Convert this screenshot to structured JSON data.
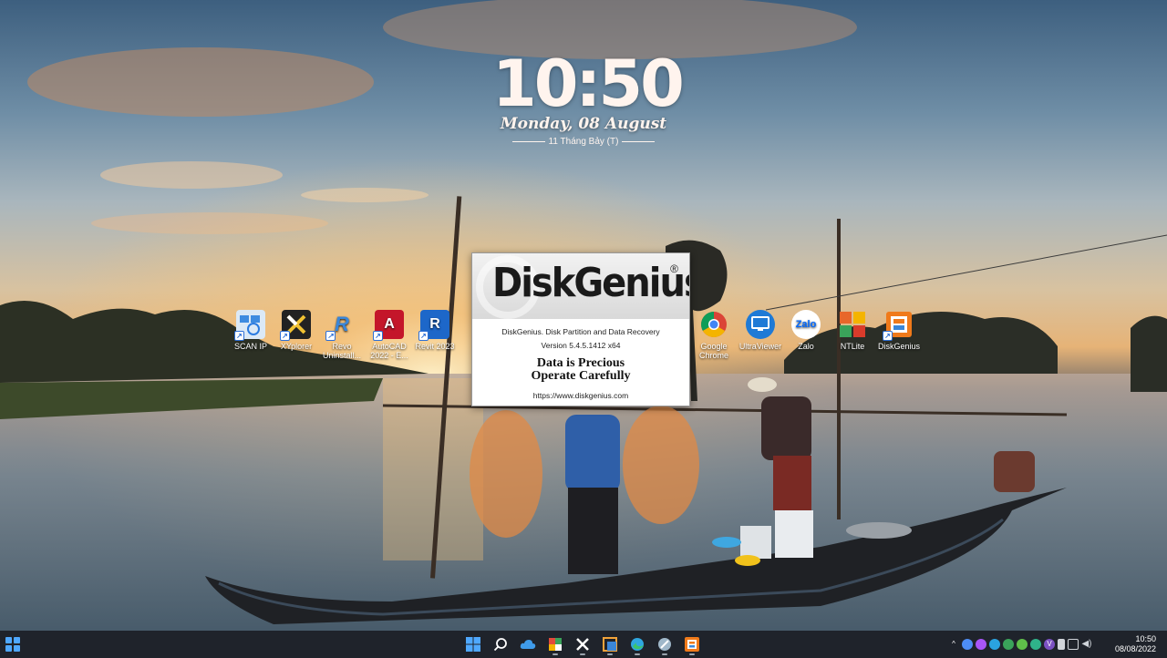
{
  "clock": {
    "time": "10:50",
    "date": "Monday, 08 August",
    "lunar": "11 Tháng Bảy (T)"
  },
  "desktop_icons": [
    {
      "label": "SCAN IP",
      "icon": "scan-ip-icon",
      "color": "#5aa0e0"
    },
    {
      "label": "XYplorer",
      "icon": "xyplorer-icon",
      "color": "#222222"
    },
    {
      "label": "Revo Uninstall...",
      "icon": "revo-uninstaller-icon",
      "color": "#3a86d8"
    },
    {
      "label": "AutoCAD 2022 - E...",
      "icon": "autocad-icon",
      "color": "#c4162a"
    },
    {
      "label": "Revit 2023",
      "icon": "revit-icon",
      "color": "#1d67c9"
    },
    {
      "label": "Google Chrome",
      "icon": "chrome-icon",
      "color": "#4285f4"
    },
    {
      "label": "UltraViewer",
      "icon": "ultraviewer-icon",
      "color": "#1f7ad6"
    },
    {
      "label": "Zalo",
      "icon": "zalo-icon",
      "color": "#0068ff"
    },
    {
      "label": "NTLite",
      "icon": "ntlite-icon",
      "color": "#e8672a"
    },
    {
      "label": "DiskGenius",
      "icon": "diskgenius-icon",
      "color": "#f07a1a"
    }
  ],
  "splash": {
    "logo": "DiskGenius",
    "registered": "®",
    "description": "DiskGenius. Disk Partition and Data Recovery",
    "version": "Version 5.4.5.1412 x64",
    "motto_line1": "Data is Precious",
    "motto_line2": "Operate Carefully",
    "url": "https://www.diskgenius.com"
  },
  "taskbar": {
    "start_icon": "windows-start-icon",
    "apps": [
      {
        "name": "start-button",
        "icon": "windows-logo-icon",
        "glyph": "▦",
        "color": "#4fa8ff"
      },
      {
        "name": "search-button",
        "icon": "search-icon",
        "glyph": "⌕",
        "color": "#ffffff"
      },
      {
        "name": "onedrive-button",
        "icon": "onedrive-icon",
        "glyph": "☁",
        "color": "#3f9bea"
      },
      {
        "name": "app-button-1",
        "icon": "app-store-icon",
        "glyph": "◆",
        "color": "#e14b3b"
      },
      {
        "name": "xyplorer-button",
        "icon": "xyplorer-icon",
        "glyph": "✕",
        "color": "#ffffff"
      },
      {
        "name": "app-button-2",
        "icon": "window-capture-icon",
        "glyph": "▣",
        "color": "#f2a33a"
      },
      {
        "name": "edge-button",
        "icon": "edge-icon",
        "glyph": "◉",
        "color": "#2fa7e0"
      },
      {
        "name": "app-button-3",
        "icon": "tool-icon",
        "glyph": "✎",
        "color": "#9fb7c9"
      },
      {
        "name": "diskgenius-button",
        "icon": "diskgenius-icon",
        "glyph": "▤",
        "color": "#f07a1a"
      }
    ],
    "tray": [
      {
        "icon": "chevron-up-icon",
        "glyph": "^",
        "color": "#1f232b"
      },
      {
        "icon": "chat-icon",
        "glyph": "•",
        "color": "#4d8df5"
      },
      {
        "icon": "messenger-icon",
        "glyph": "•",
        "color": "#a855f7"
      },
      {
        "icon": "telegram-icon",
        "glyph": "•",
        "color": "#2aa3e0"
      },
      {
        "icon": "update-icon",
        "glyph": "•",
        "color": "#3aa35a"
      },
      {
        "icon": "sync-icon",
        "glyph": "•",
        "color": "#5fbf4a"
      },
      {
        "icon": "shield-icon",
        "glyph": "•",
        "color": "#2fb38a"
      },
      {
        "icon": "viber-icon",
        "glyph": "V",
        "color": "#7b51c2"
      },
      {
        "icon": "usb-icon",
        "glyph": "•",
        "color": "#d0d4da"
      },
      {
        "icon": "network-icon",
        "glyph": "•",
        "color": "#d0d4da"
      },
      {
        "icon": "volume-icon",
        "glyph": "•",
        "color": "#d0d4da"
      }
    ],
    "time": "10:50",
    "date": "08/08/2022"
  }
}
